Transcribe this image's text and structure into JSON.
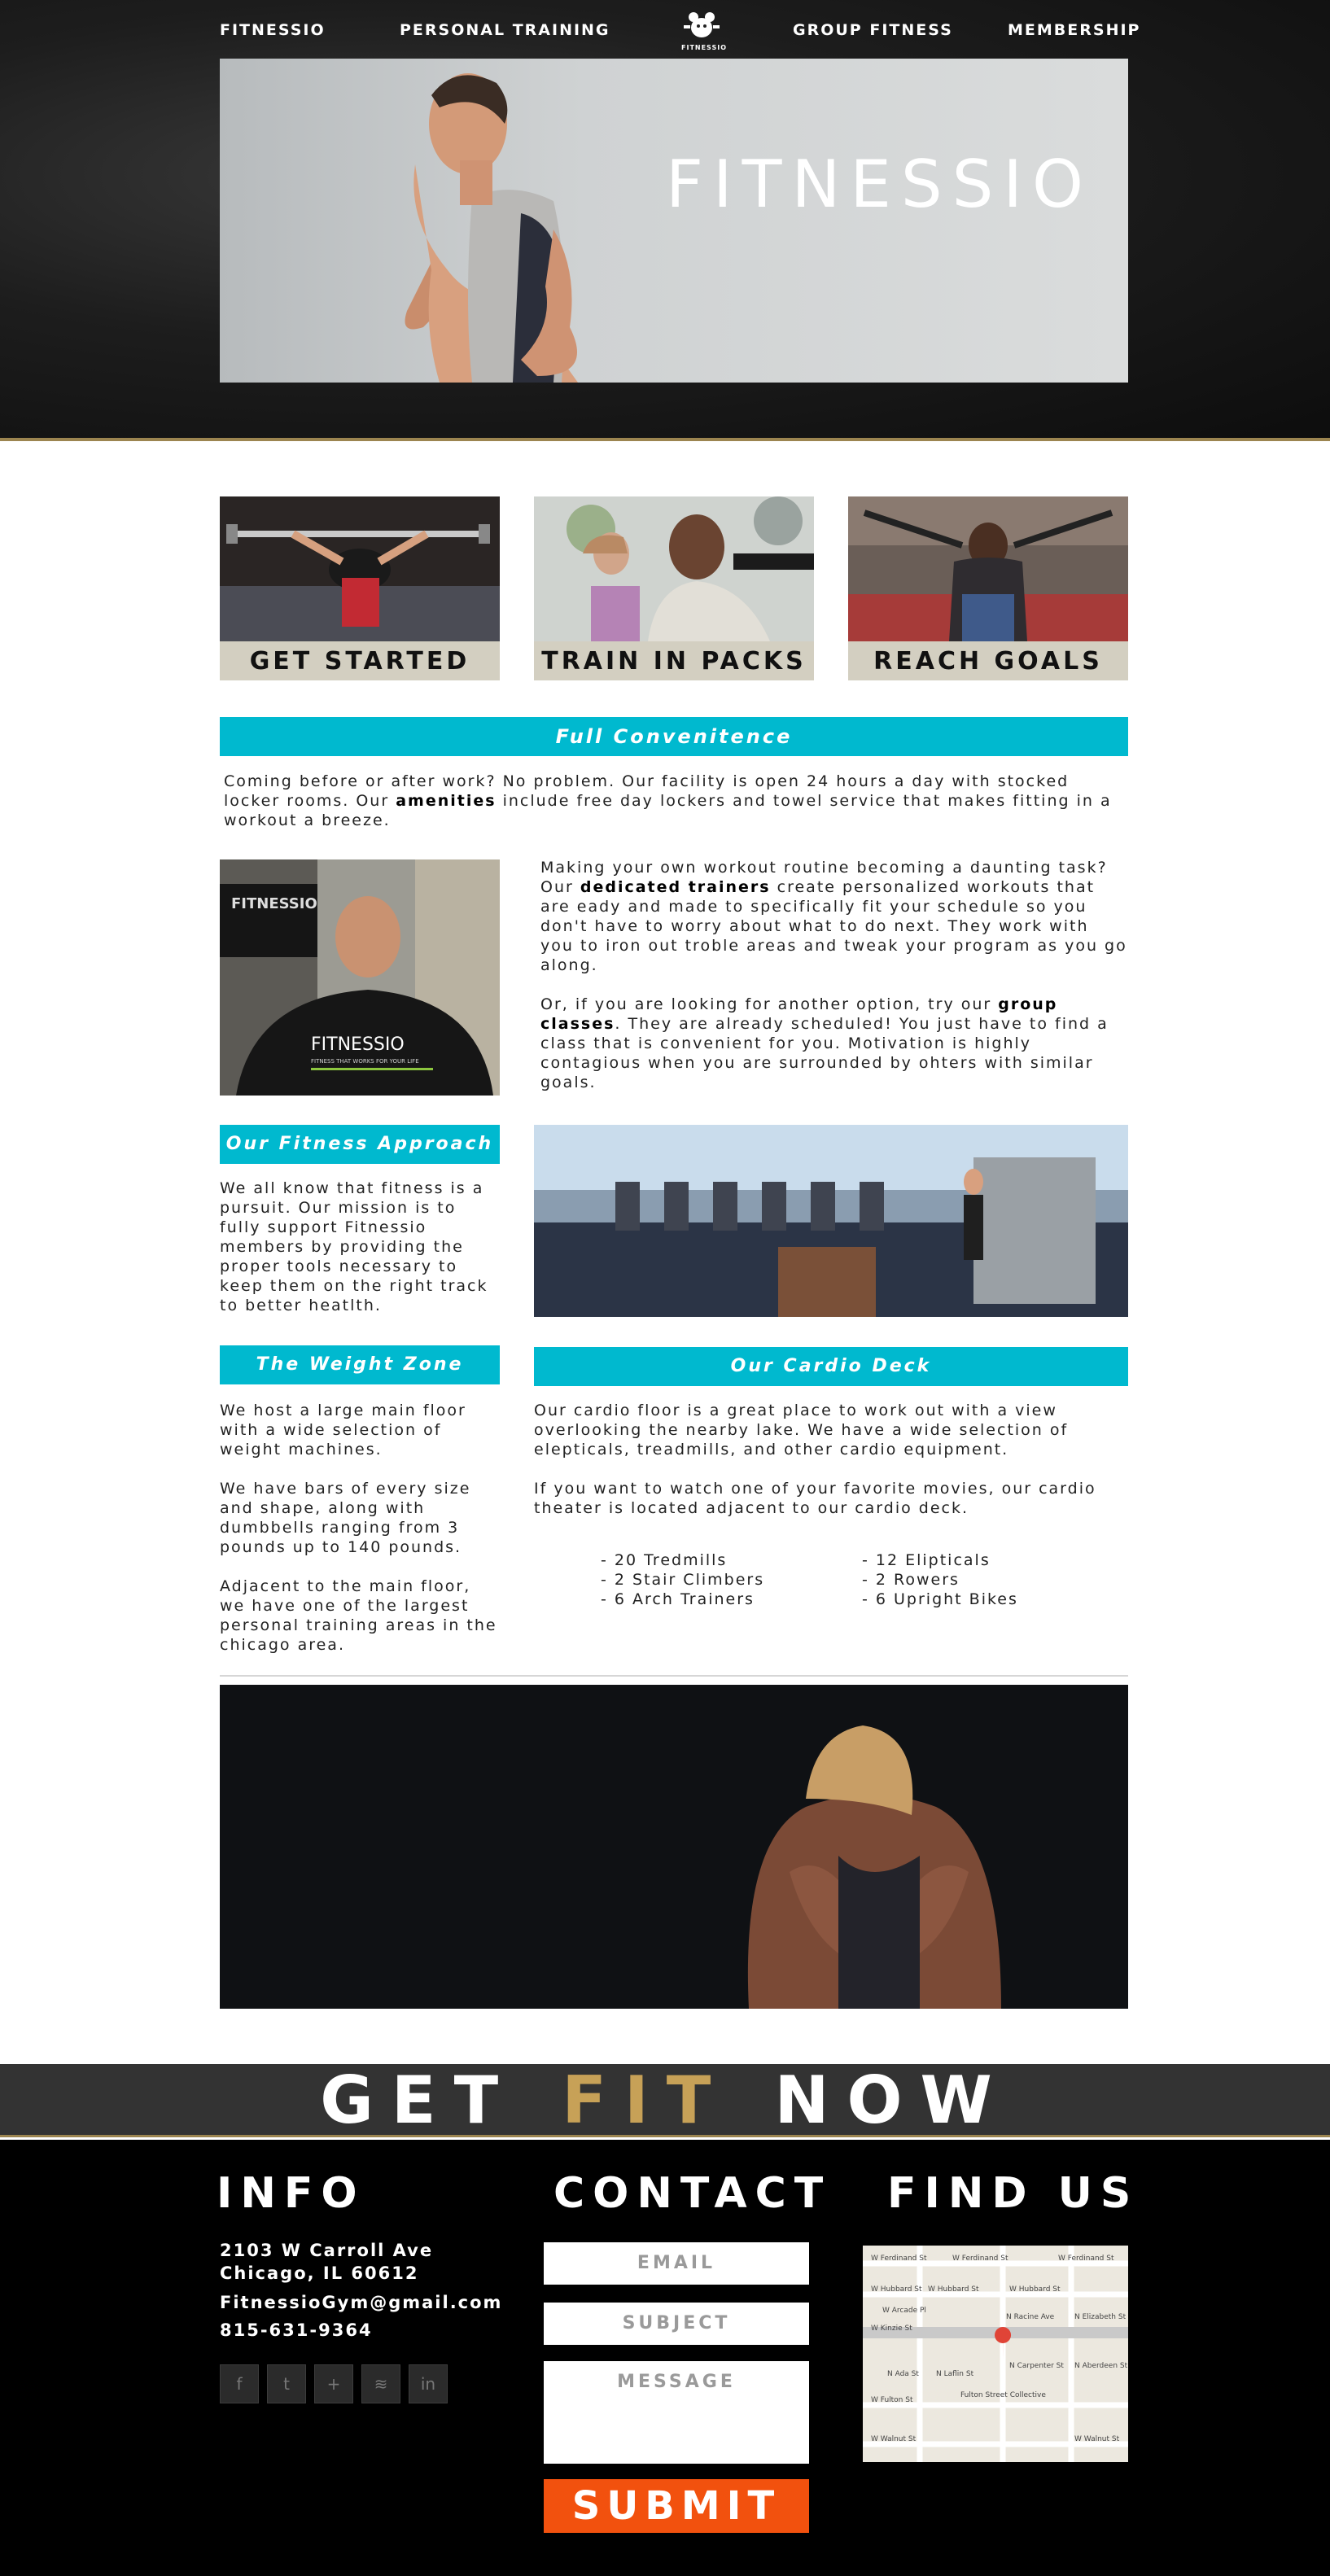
{
  "nav": {
    "items": [
      "FITNESSIO",
      "PERSONAL TRAINING",
      "GROUP FITNESS",
      "MEMBERSHIP"
    ],
    "logo_text": "FITNESSIO"
  },
  "hero": {
    "title": "FITNESSIO"
  },
  "tiles": [
    {
      "label": "GET STARTED"
    },
    {
      "label": "TRAIN IN PACKS"
    },
    {
      "label": "REACH GOALS"
    }
  ],
  "convenience": {
    "heading": "Full Convenitence",
    "text_before": "Coming before or after work? No problem. Our facility is open 24 hours a day with stocked locker rooms. Our ",
    "bold": "amenities",
    "text_after": " include free day lockers and towel service that makes fitting in a workout a breeze."
  },
  "trainers": {
    "p1_before": "Making your own workout routine becoming a daunting task? Our ",
    "p1_bold": "dedicated trainers",
    "p1_after": " create personalized workouts that are eady and made to specifically fit your schedule so you don't have to worry about what to do next. They work with you to iron out troble areas and tweak your program as you go along.",
    "p2_before": "Or, if you are looking for another option, try our ",
    "p2_bold": "group classes",
    "p2_after": ". They are already scheduled! You just have to find a class that is convenient for you. Motivation is highly contagious when you are surrounded by ohters with similar goals.",
    "shirt_text": "FITNESSIO",
    "shirt_tagline": "FITNESS THAT WORKS FOR YOUR LIFE",
    "sign_text": "FITNESSIO"
  },
  "approach": {
    "heading": "Our Fitness Approach",
    "text": "We all know that fitness is a pursuit. Our mission is to fully support Fitnessio members by providing the proper tools necessary to keep them on the right track to better heatlth."
  },
  "weight_zone": {
    "heading": "The Weight Zone",
    "paragraphs": [
      "We host a large main floor with a wide selection of weight machines.",
      "We have bars of every size and shape, along with dumbbells ranging from 3 pounds up to 140 pounds.",
      "Adjacent to the main floor, we have one of the largest personal training areas in the chicago area."
    ]
  },
  "cardio": {
    "heading": "Our Cardio Deck",
    "paragraphs": [
      "Our cardio floor is a great place to work out with a view overlooking the nearby lake. We have a wide selection of elepticals, treadmills, and other cardio equipment.",
      "If you want to watch one of your favorite movies, our cardio theater is located adjacent to our cardio deck."
    ],
    "equipment_left": [
      "- 20 Tredmills",
      "- 2 Stair Climbers",
      "- 6 Arch Trainers"
    ],
    "equipment_right": [
      "- 12 Elipticals",
      "- 2 Rowers",
      "- 6 Upright Bikes"
    ]
  },
  "cta": {
    "word1": "GET",
    "word2": "FIT",
    "word3": "NOW"
  },
  "footer": {
    "info_heading": "INFO",
    "address1": "2103 W Carroll Ave",
    "address2": "Chicago, IL 60612",
    "email": "FitnessioGym@gmail.com",
    "phone": "815-631-9364",
    "social_icons": [
      "facebook-icon",
      "twitter-icon",
      "plus-icon",
      "rss-icon",
      "linkedin-icon"
    ],
    "contact_heading": "CONTACT",
    "email_placeholder": "EMAIL",
    "subject_placeholder": "SUBJECT",
    "message_placeholder": "MESSAGE",
    "submit_label": "SUBMIT",
    "find_heading": "FIND US",
    "map_labels": [
      "W Ferdinand St",
      "W Ferdinand St",
      "W Ferdinand St",
      "W Hubbard St",
      "W Hubbard St",
      "W Hubbard St",
      "W Kinzie St",
      "W Fulton St",
      "W Walnut St",
      "W Walnut St",
      "W Arcade Pl",
      "N Laflin St",
      "N Ada St",
      "N Racine Ave",
      "N Elizabeth St",
      "N Carpenter St",
      "N Aberdeen St",
      "Fulton Street Collective"
    ],
    "accent_color": "#00b9cf",
    "submit_color": "#f2510e",
    "gold_color": "#c7a157"
  }
}
